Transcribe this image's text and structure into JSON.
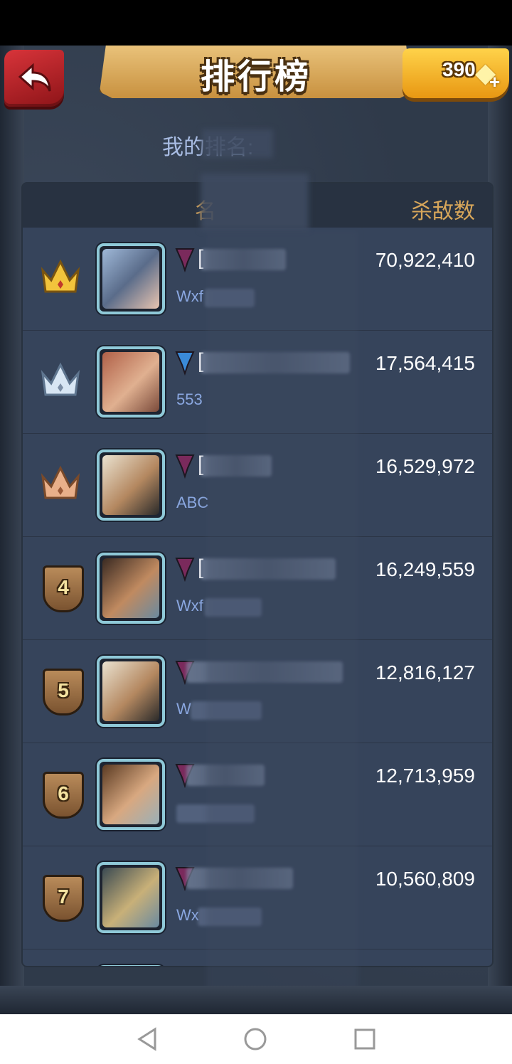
{
  "header": {
    "title": "排行榜",
    "gems": "390",
    "gem_icon": "diamond-icon"
  },
  "my_rank_label": "我的排名:",
  "table": {
    "col_name": "名",
    "col_kills": "杀敌数",
    "rows": [
      {
        "rank": "1",
        "badge": "gold-crown",
        "flag_color": "#7a2a5c",
        "name": "[",
        "sub": "Wxf",
        "kills": "70,922,410"
      },
      {
        "rank": "2",
        "badge": "silver-crown",
        "flag_color": "#3a8ad8",
        "name": "[",
        "sub": "553",
        "kills": "17,564,415"
      },
      {
        "rank": "3",
        "badge": "bronze-crown",
        "flag_color": "#7a2a5c",
        "name": "[",
        "sub": "ABC",
        "kills": "16,529,972"
      },
      {
        "rank": "4",
        "badge": "shield",
        "flag_color": "#7a2a5c",
        "name": "[",
        "sub": "Wxf",
        "kills": "16,249,559"
      },
      {
        "rank": "5",
        "badge": "shield",
        "flag_color": "#7a2a5c",
        "name": "",
        "sub": "W",
        "kills": "12,816,127"
      },
      {
        "rank": "6",
        "badge": "shield",
        "flag_color": "#7a2a5c",
        "name": "",
        "sub": "",
        "kills": "12,713,959"
      },
      {
        "rank": "7",
        "badge": "shield",
        "flag_color": "#7a2a5c",
        "name": "",
        "sub": "Wx",
        "kills": "10,560,809"
      }
    ]
  },
  "colors": {
    "accent_gold": "#d7a65a",
    "panel": "#36445b"
  }
}
